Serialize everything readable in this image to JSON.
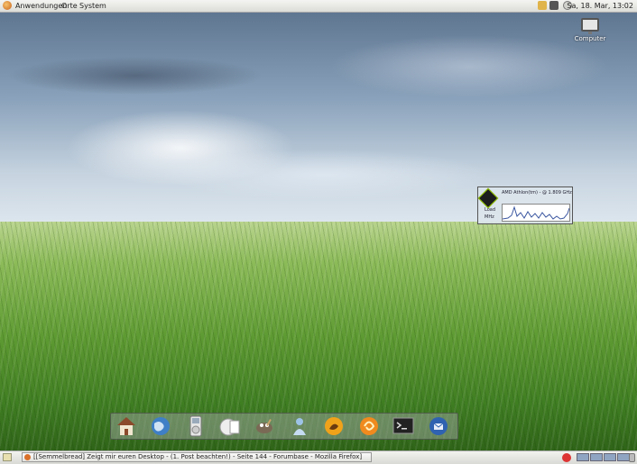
{
  "top_panel": {
    "menus": [
      "Anwendungen",
      "Orte",
      "System"
    ],
    "clock": "Sa, 18. Mar, 13:02",
    "tray_icons": [
      "notes-icon",
      "network-icon",
      "volume-icon"
    ]
  },
  "desktop": {
    "icons": [
      {
        "label": "Computer",
        "icon": "computer-icon"
      }
    ]
  },
  "cpu_widget": {
    "title": "AMD Athlon(tm) - @ 1.809 GHz",
    "label_load": "Load",
    "label_freq": "MHz"
  },
  "dock": {
    "items": [
      {
        "name": "home-folder",
        "icon": "home-icon"
      },
      {
        "name": "web-browser",
        "icon": "globe-icon"
      },
      {
        "name": "music-player",
        "icon": "ipod-icon"
      },
      {
        "name": "file-manager",
        "icon": "folder-icon"
      },
      {
        "name": "image-editor",
        "icon": "gimp-icon"
      },
      {
        "name": "messenger",
        "icon": "contact-icon"
      },
      {
        "name": "media-player",
        "icon": "media-icon"
      },
      {
        "name": "multimedia-app",
        "icon": "orange-swirl-icon"
      },
      {
        "name": "terminal",
        "icon": "terminal-icon"
      },
      {
        "name": "email-client",
        "icon": "thunderbird-icon"
      }
    ]
  },
  "bottom_panel": {
    "task_title": "[[Semmelbread] Zeigt mir euren Desktop - (1. Post beachten!) - Seite 144 - Forumbase - Mozilla Firefox]",
    "workspaces": 4
  },
  "colors": {
    "panel": "#e6e6e2",
    "sky_top": "#5f7691",
    "grass": "#5f9b33",
    "cpu_graph_line": "#3a56a0"
  }
}
